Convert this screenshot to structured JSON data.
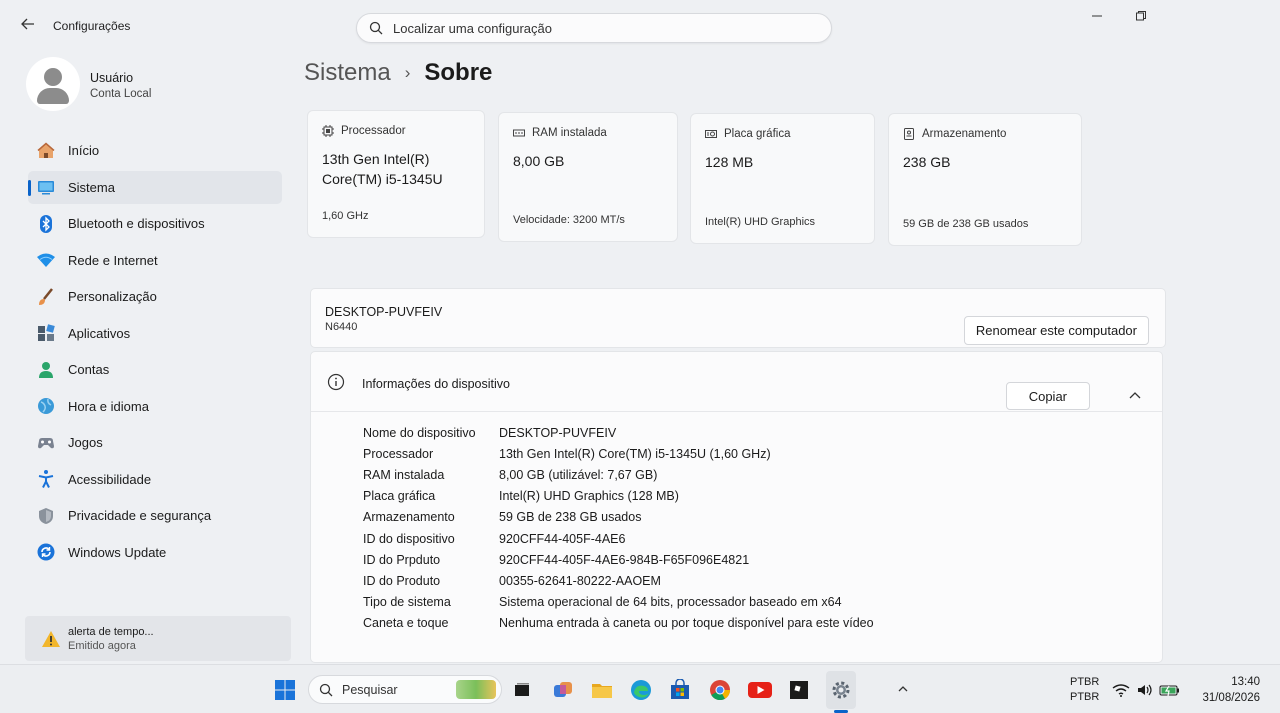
{
  "window": {
    "title": "Configurações",
    "search_placeholder": "Localizar uma configuração"
  },
  "user": {
    "name": "Usuário",
    "account_type": "Conta Local"
  },
  "sidebar": {
    "items": [
      {
        "label": "Início",
        "icon": "home-icon"
      },
      {
        "label": "Sistema",
        "icon": "system-icon",
        "active": true
      },
      {
        "label": "Bluetooth e dispositivos",
        "icon": "bluetooth-icon"
      },
      {
        "label": "Rede e Internet",
        "icon": "wifi-icon"
      },
      {
        "label": "Personalização",
        "icon": "brush-icon"
      },
      {
        "label": "Aplicativos",
        "icon": "apps-icon"
      },
      {
        "label": "Contas",
        "icon": "accounts-icon"
      },
      {
        "label": "Hora e idioma",
        "icon": "globe-icon"
      },
      {
        "label": "Jogos",
        "icon": "gamepad-icon"
      },
      {
        "label": "Acessibilidade",
        "icon": "accessibility-icon"
      },
      {
        "label": "Privacidade e segurança",
        "icon": "shield-icon"
      },
      {
        "label": "Windows Update",
        "icon": "update-icon"
      }
    ]
  },
  "notification": {
    "title": "alerta de tempo...",
    "subtitle": "Emitido agora"
  },
  "breadcrumb": {
    "parent": "Sistema",
    "separator": "›",
    "current": "Sobre"
  },
  "specs": {
    "processor": {
      "label": "Processador",
      "value": "13th Gen Intel(R) Core(TM) i5-1345U",
      "sub": "1,60 GHz"
    },
    "ram": {
      "label": "RAM instalada",
      "value": "8,00 GB",
      "sub": "Velocidade: 3200 MT/s"
    },
    "gpu": {
      "label": "Placa gráfica",
      "value": "128 MB",
      "sub": "Intel(R) UHD Graphics"
    },
    "storage": {
      "label": "Armazenamento",
      "value": "238 GB",
      "sub": "59 GB de 238 GB usados"
    }
  },
  "computer": {
    "name": "DESKTOP-PUVFEIV",
    "model": "N6440",
    "rename_label": "Renomear este computador"
  },
  "device_info": {
    "title": "Informações do dispositivo",
    "copy_label": "Copiar",
    "rows": [
      {
        "key": "Nome do dispositivo",
        "value": "DESKTOP-PUVFEIV"
      },
      {
        "key": "Processador",
        "value": "13th Gen Intel(R) Core(TM) i5-1345U (1,60 GHz)"
      },
      {
        "key": "RAM instalada",
        "value": "8,00 GB (utilizável: 7,67 GB)"
      },
      {
        "key": "Placa gráfica",
        "value": "Intel(R) UHD Graphics (128 MB)"
      },
      {
        "key": "Armazenamento",
        "value": "59 GB de 238 GB usados"
      },
      {
        "key": "ID do dispositivo",
        "value": "920CFF44-405F-4AE6"
      },
      {
        "key": "ID do Prpduto",
        "value": "920CFF44-405F-4AE6-984B-F65F096E4821"
      },
      {
        "key": "ID do Produto",
        "value": "00355-62641-80222-AAOEM"
      },
      {
        "key": "Tipo de sistema",
        "value": "Sistema operacional de 64 bits, processador baseado em x64"
      },
      {
        "key": "Caneta e toque",
        "value": "Nenhuma entrada à caneta ou por toque disponível para este vídeo"
      }
    ]
  },
  "taskbar": {
    "search_label": "Pesquisar",
    "lang_line1": "PTBR",
    "lang_line2": "PTBR",
    "time": "13:40",
    "date": "31/08/2026"
  },
  "colors": {
    "accent": "#0a63c9",
    "background": "#eef0f3",
    "card": "#f8f9fa"
  }
}
